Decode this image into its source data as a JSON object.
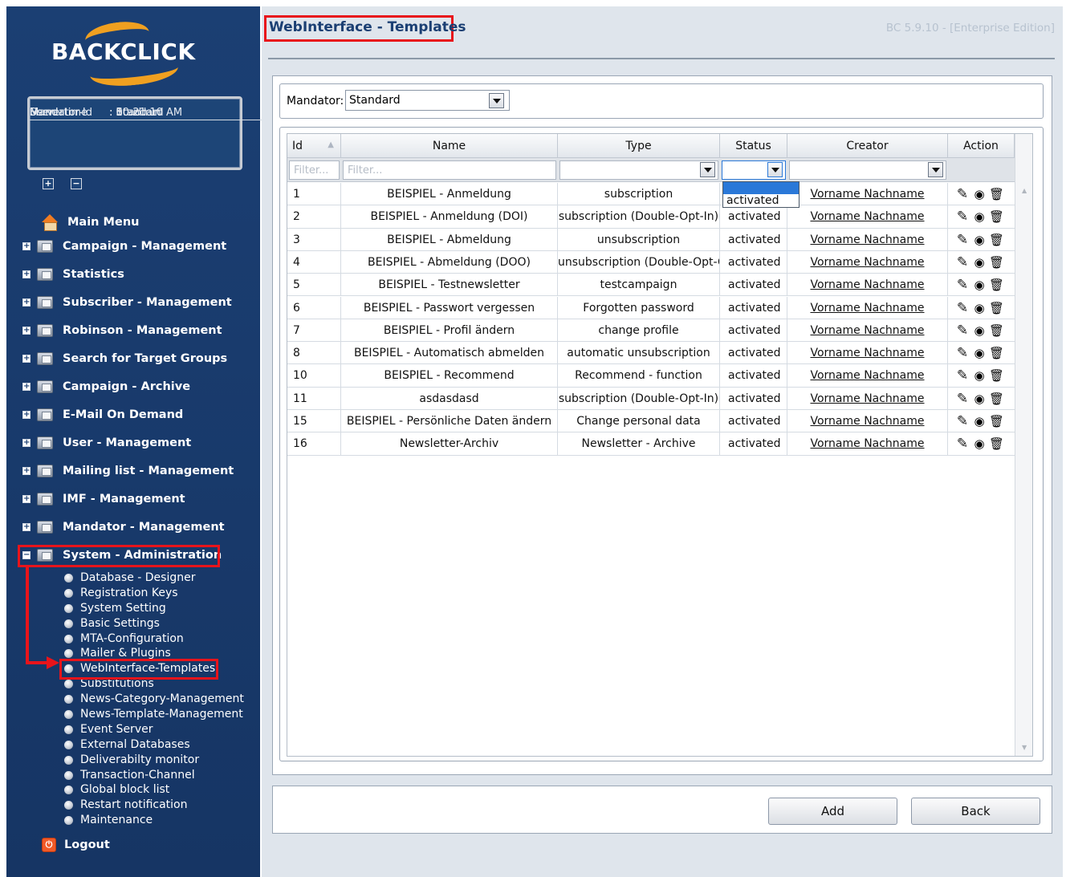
{
  "app": {
    "logo_text": "BACKCLICK",
    "version": "BC 5.9.10 - [Enterprise Edition]"
  },
  "info": {
    "rows": [
      {
        "key": "Servertime",
        "value": ": 10:21:10 AM"
      },
      {
        "key": "Mandator",
        "value": ": Standard"
      },
      {
        "key": "Mandator-Id",
        "value": ": 0"
      },
      {
        "key": "User",
        "value": ": bcadmin"
      }
    ]
  },
  "sidebar": {
    "expand_all": "+",
    "collapse_all": "−",
    "main_menu": "Main Menu",
    "items": [
      "Campaign - Management",
      "Statistics",
      "Subscriber - Management",
      "Robinson - Management",
      "Search for Target Groups",
      "Campaign - Archive",
      "E-Mail On Demand",
      "User - Management",
      "Mailing list - Management",
      "IMF - Management",
      "Mandator - Management",
      "System - Administration"
    ],
    "sub_items": [
      "Database - Designer",
      "Registration Keys",
      "System Setting",
      "Basic Settings",
      "MTA-Configuration",
      "Mailer & Plugins",
      "WebInterface-Templates",
      "Substitutions",
      "News-Category-Management",
      "News-Template-Management",
      "Event Server",
      "External Databases",
      "Deliverabilty monitor",
      "Transaction-Channel",
      "Global block list",
      "Restart notification",
      "Maintenance"
    ],
    "logout": "Logout"
  },
  "page": {
    "title": "WebInterface - Templates"
  },
  "mandator": {
    "label": "Mandator:",
    "value": "Standard"
  },
  "grid": {
    "headers": {
      "id": "Id",
      "name": "Name",
      "type": "Type",
      "status": "Status",
      "creator": "Creator",
      "action": "Action"
    },
    "filter_placeholder_id": "Filter...",
    "filter_placeholder_name": "Filter...",
    "status_dropdown_option": "activated",
    "rows": [
      {
        "id": "1",
        "name": "BEISPIEL - Anmeldung",
        "type": "subscription",
        "status": "",
        "creator": "Vorname Nachname"
      },
      {
        "id": "2",
        "name": "BEISPIEL - Anmeldung (DOI)",
        "type": "subscription (Double-Opt-In)",
        "status": "activated",
        "creator": "Vorname Nachname"
      },
      {
        "id": "3",
        "name": "BEISPIEL - Abmeldung",
        "type": "unsubscription",
        "status": "activated",
        "creator": "Vorname Nachname"
      },
      {
        "id": "4",
        "name": "BEISPIEL - Abmeldung (DOO)",
        "type": "unsubscription (Double-Opt-Out)",
        "status": "activated",
        "creator": "Vorname Nachname"
      },
      {
        "id": "5",
        "name": "BEISPIEL - Testnewsletter",
        "type": "testcampaign",
        "status": "activated",
        "creator": "Vorname Nachname"
      },
      {
        "id": "6",
        "name": "BEISPIEL - Passwort vergessen",
        "type": "Forgotten password",
        "status": "activated",
        "creator": "Vorname Nachname"
      },
      {
        "id": "7",
        "name": "BEISPIEL - Profil ändern",
        "type": "change profile",
        "status": "activated",
        "creator": "Vorname Nachname"
      },
      {
        "id": "8",
        "name": "BEISPIEL - Automatisch abmelden",
        "type": "automatic unsubscription",
        "status": "activated",
        "creator": "Vorname Nachname"
      },
      {
        "id": "10",
        "name": "BEISPIEL - Recommend",
        "type": "Recommend - function",
        "status": "activated",
        "creator": "Vorname Nachname"
      },
      {
        "id": "11",
        "name": "asdasdasd",
        "type": "subscription (Double-Opt-In)",
        "status": "activated",
        "creator": "Vorname Nachname"
      },
      {
        "id": "15",
        "name": "BEISPIEL - Persönliche Daten ändern",
        "type": "Change personal data",
        "status": "activated",
        "creator": "Vorname Nachname"
      },
      {
        "id": "16",
        "name": "Newsletter-Archiv",
        "type": "Newsletter - Archive",
        "status": "activated",
        "creator": "Vorname Nachname"
      }
    ]
  },
  "buttons": {
    "add": "Add",
    "back": "Back"
  }
}
